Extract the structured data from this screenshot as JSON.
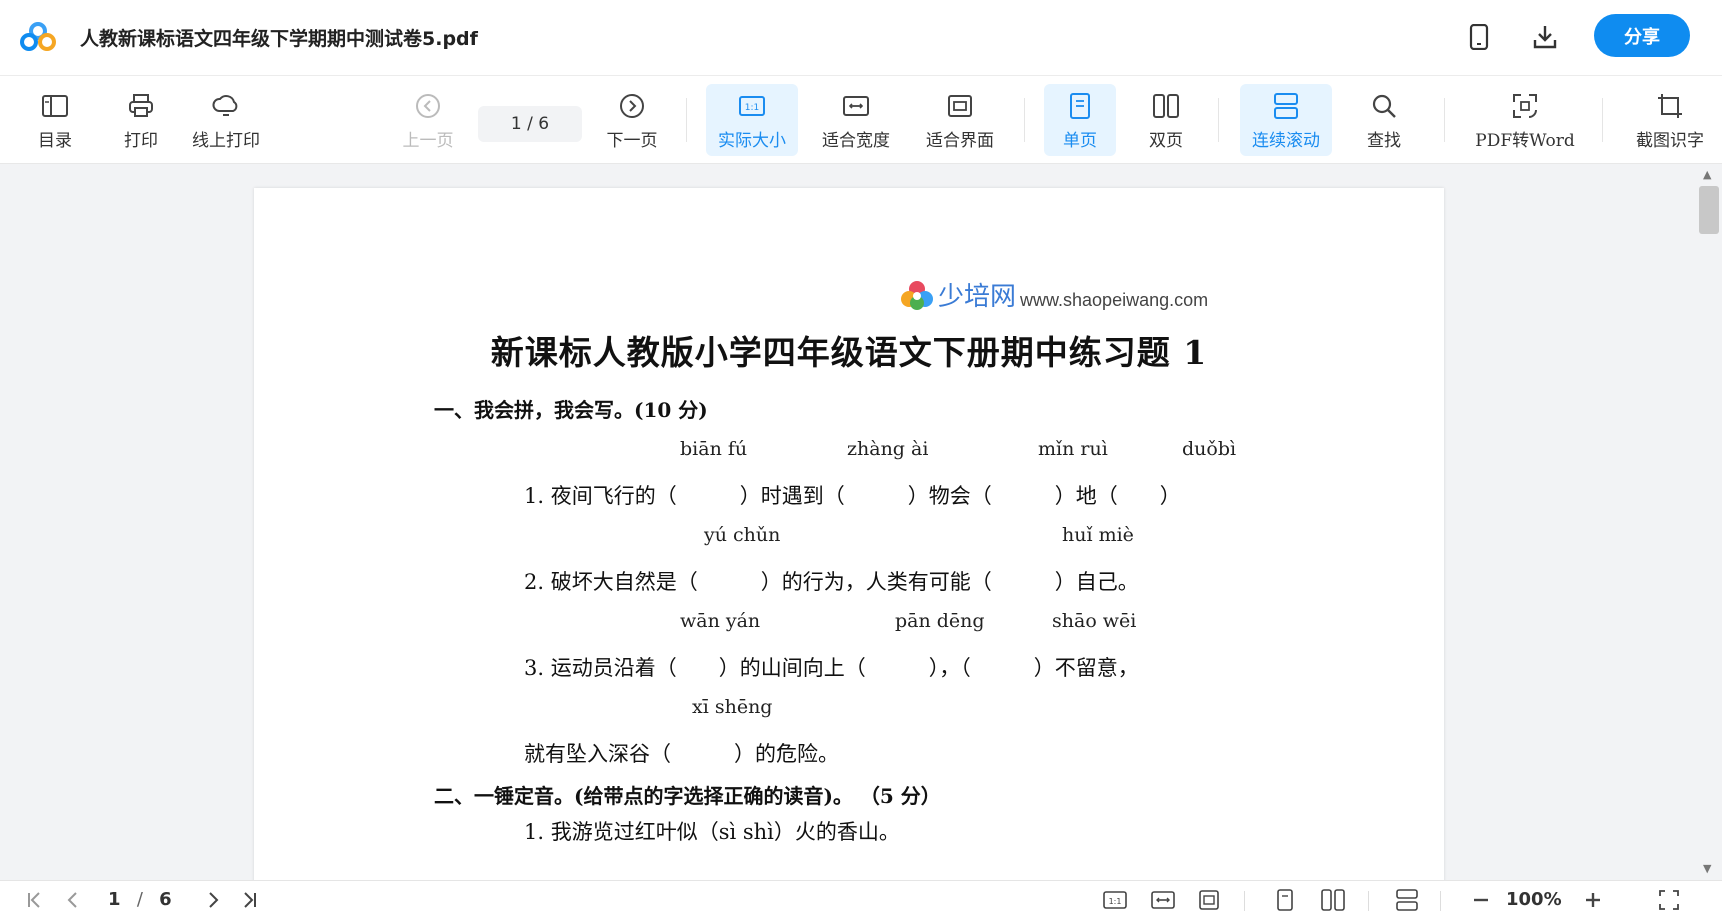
{
  "window": {
    "title": "人教新课标语文四年级下学期期中测试卷5.pdf",
    "share_label": "分享"
  },
  "toolbar": {
    "toc": "目录",
    "print": "打印",
    "online_print": "线上打印",
    "prev_page": "上一页",
    "page_indicator": "1  /  6",
    "next_page": "下一页",
    "actual_size": "实际大小",
    "fit_width": "适合宽度",
    "fit_window": "适合界面",
    "single_page": "单页",
    "double_page": "双页",
    "continuous_scroll": "连续滚动",
    "search": "查找",
    "pdf_to_word": "PDF转Word",
    "screenshot_ocr": "截图识字"
  },
  "document": {
    "logo_text": "少培网",
    "logo_url": "www.shaopeiwang.com",
    "heading": "新课标人教版小学四年级语文下册期中练习题 1",
    "section1_title": "一、我会拼，我会写。(10 分)",
    "q1_pinyin": [
      "biān fú",
      "zhàng ài",
      "mǐn ruì",
      "duǒbì"
    ],
    "q1_text": "1. 夜间飞行的（　　　）时遇到（　　　）物会（　　　）地（　　）",
    "q2_pinyin": [
      "yú  chǔn",
      "huǐ  miè"
    ],
    "q2_text": "2. 破坏大自然是（　　　）的行为，人类有可能（　　　）自己。",
    "q3_pinyin": [
      "wān yán",
      "pān dēng",
      "shāo  wēi"
    ],
    "q3_text": "3. 运动员沿着（　　）的山间向上（　　　），（　　　）不留意，",
    "q3b_pinyin": "xī shēng",
    "q3b_text": "就有坠入深谷（　　　）的危险。",
    "section2_title": "二、一锤定音。(给带点的字选择正确的读音)。 （5 分）",
    "s2_q1": "1. 我游览过红叶似（sì shì）火的香山。"
  },
  "bottombar": {
    "current_page": "1",
    "page_sep": "/",
    "total_pages": "6",
    "zoom": "100%"
  },
  "colors": {
    "accent": "#0f8cf0",
    "active_bg": "#e6f4ff",
    "active_text": "#1a8cf0"
  }
}
